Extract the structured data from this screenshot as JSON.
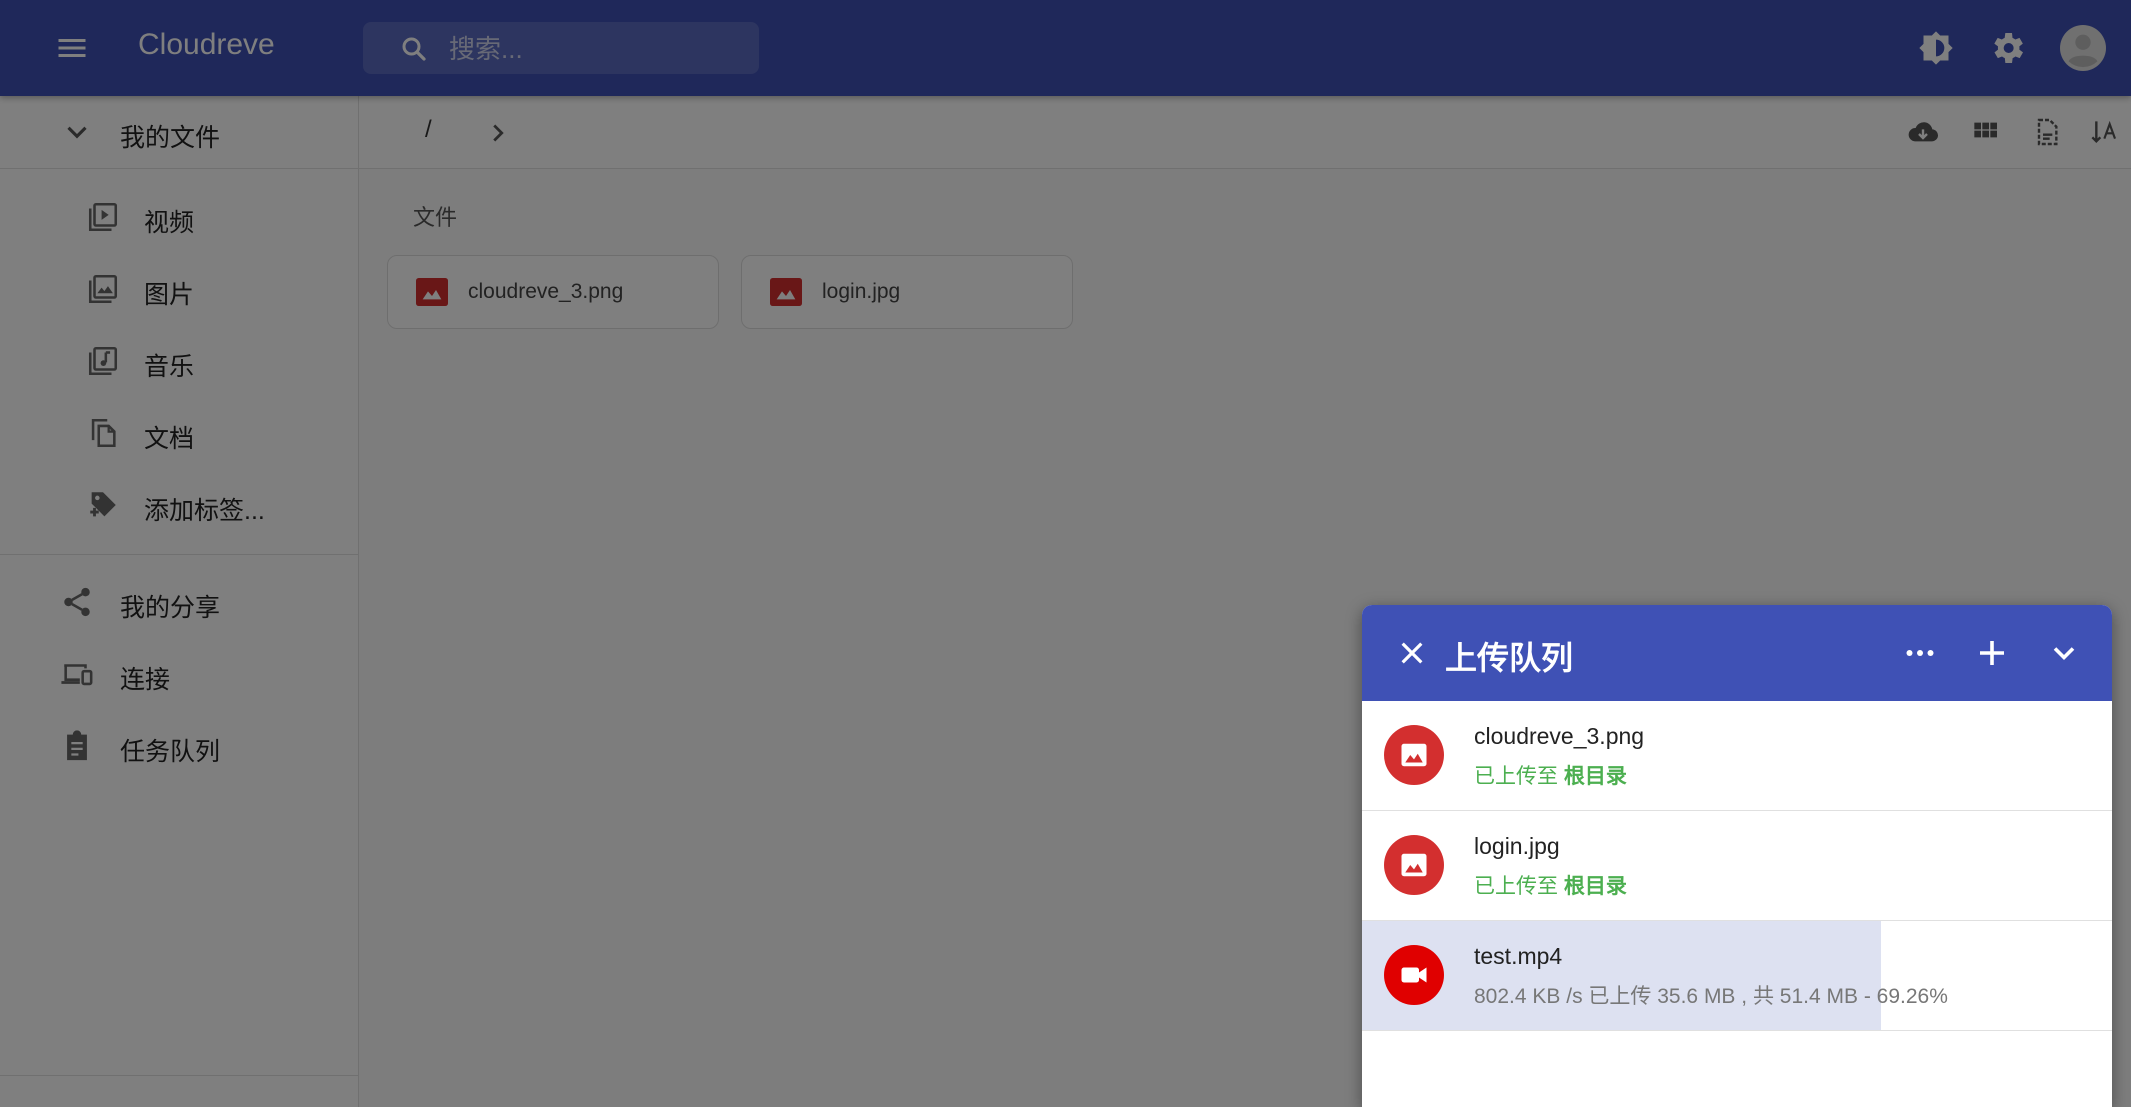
{
  "appbar": {
    "brand": "Cloudreve",
    "search_placeholder": "搜索...",
    "color": "#3f51b5"
  },
  "sidebar": {
    "my_files": "我的文件",
    "sub_items": [
      {
        "label": "视频",
        "icon": "video-library-icon"
      },
      {
        "label": "图片",
        "icon": "photo-library-icon"
      },
      {
        "label": "音乐",
        "icon": "music-library-icon"
      },
      {
        "label": "文档",
        "icon": "document-copy-icon"
      },
      {
        "label": "添加标签...",
        "icon": "add-tag-icon"
      }
    ],
    "items": [
      {
        "label": "我的分享",
        "icon": "share-icon"
      },
      {
        "label": "连接",
        "icon": "devices-icon"
      },
      {
        "label": "任务队列",
        "icon": "task-queue-icon"
      }
    ]
  },
  "breadcrumb": {
    "root": "/"
  },
  "content": {
    "section_title": "文件",
    "files": [
      {
        "name": "cloudreve_3.png"
      },
      {
        "name": "login.jpg"
      }
    ]
  },
  "upload_queue": {
    "title": "上传队列",
    "items": [
      {
        "name": "cloudreve_3.png",
        "status_prefix": "已上传至 ",
        "status_target": "根目录",
        "type": "image",
        "progress": 1.0
      },
      {
        "name": "login.jpg",
        "status_prefix": "已上传至 ",
        "status_target": "根目录",
        "type": "image",
        "progress": 1.0
      },
      {
        "name": "test.mp4",
        "status": "802.4 KB /s 已上传 35.6 MB , 共 51.4 MB - 69.26%",
        "type": "video",
        "progress": 0.6926
      }
    ]
  }
}
